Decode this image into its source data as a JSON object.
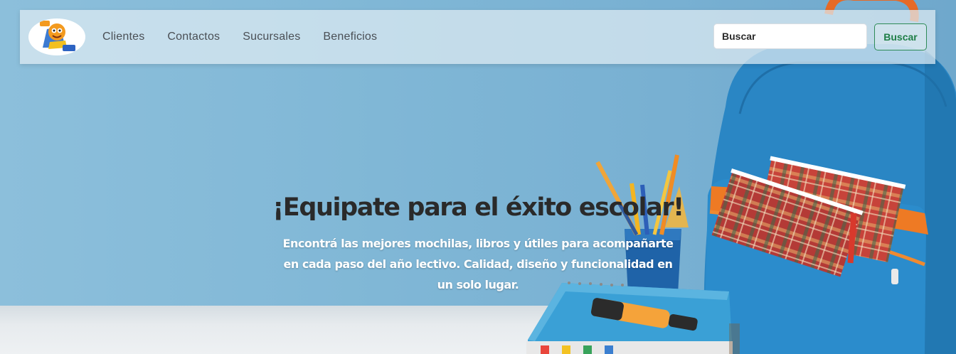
{
  "nav": {
    "logo_alt": "Logo",
    "links": [
      {
        "label": "Clientes"
      },
      {
        "label": "Contactos"
      },
      {
        "label": "Sucursales"
      },
      {
        "label": "Beneficios"
      }
    ],
    "search": {
      "placeholder": "Buscar",
      "button_label": "Buscar"
    }
  },
  "hero": {
    "title": "¡Equipate para el éxito escolar!",
    "subtitle": "Encontrá las mejores mochilas, libros y útiles para acompañarte en cada paso del año lectivo. Calidad, diseño y funcionalidad en un solo lugar."
  },
  "colors": {
    "brand_green": "#1e7e46",
    "sky_blue": "#80b7d6",
    "backpack_blue": "#2a86c4",
    "accent_orange": "#f07b22"
  },
  "icons": {
    "logo": "mascot-logo-icon"
  }
}
